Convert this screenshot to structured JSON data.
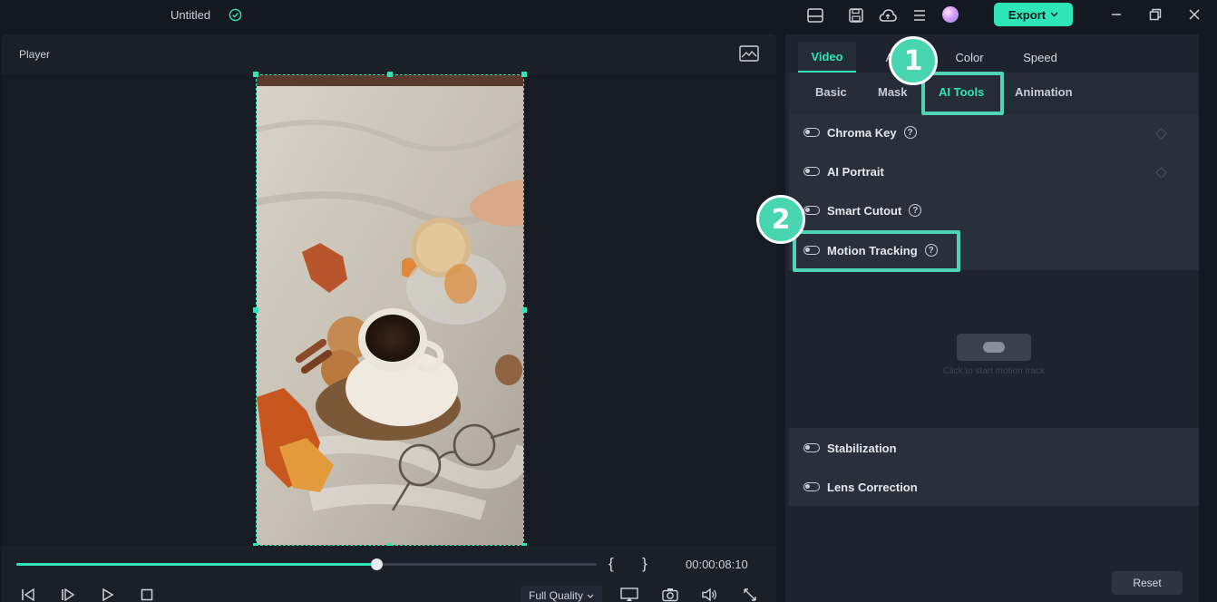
{
  "titlebar": {
    "project_title": "Untitled",
    "export_label": "Export"
  },
  "player": {
    "label": "Player",
    "timecode": "00:00:08:10",
    "progress": 0.62,
    "bracket_in": "{",
    "bracket_out": "}",
    "quality_label": "Full Quality"
  },
  "panel": {
    "tabs": [
      "Video",
      "A",
      "Color",
      "Speed"
    ],
    "active_tab": "Video",
    "subtabs": [
      "Basic",
      "Mask",
      "AI Tools",
      "Animation"
    ],
    "active_subtab": "AI Tools",
    "ai_tools": [
      {
        "label": "Chroma Key",
        "help": "?"
      },
      {
        "label": "AI Portrait"
      },
      {
        "label": "Smart Cutout",
        "help": "?"
      },
      {
        "label": "Motion Tracking",
        "help": "?"
      }
    ],
    "tracking_hint": "Click to start motion track",
    "other_tools": [
      {
        "label": "Stabilization"
      },
      {
        "label": "Lens Correction"
      }
    ],
    "reset_label": "Reset"
  },
  "annotations": {
    "step1": "1",
    "step2": "2"
  },
  "colors": {
    "accent": "#2ee6b8",
    "annotation": "#4fd5b5"
  }
}
